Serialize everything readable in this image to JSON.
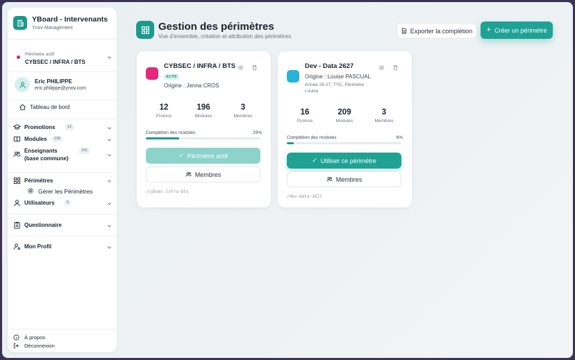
{
  "sidebar": {
    "brand_title": "YBoard - Intervenants",
    "brand_subtitle": "Ynov Management",
    "active_perimeter_label": "Périmètre actif",
    "active_perimeter_value": "CYBSEC / INFRA / BTS",
    "user_name": "Eric PHILIPPE",
    "user_email": "eric.philippe@ynov.com",
    "dashboard": "Tableau de bord",
    "promotions": {
      "label": "Promotions",
      "count": "12"
    },
    "modules": {
      "label": "Modules",
      "count": "196"
    },
    "teachers": {
      "label_line1": "Enseignants",
      "label_line2": "(base commune)",
      "count": "101"
    },
    "perimeters": "Périmètres",
    "manage_perimeters": "Gérer les Périmètres",
    "users": {
      "label": "Utilisateurs",
      "count": "5"
    },
    "questionnaire": "Questionnaire",
    "profile": "Mon Profil",
    "about": "À propos",
    "logout": "Déconnexion"
  },
  "header": {
    "title": "Gestion des périmètres",
    "subtitle": "Vue d'ensemble, création et attribution des périmètres",
    "export_label": "Exporter la complétion",
    "create_label": "Créer un périmètre"
  },
  "cards": [
    {
      "title": "CYBSEC / INFRA / BTS",
      "badge": "ACTIF",
      "origin": "Origine : Jenna CROS",
      "meta": "",
      "color": "#e3287e",
      "stats": [
        {
          "value": "12",
          "label": "Promos"
        },
        {
          "value": "196",
          "label": "Modules"
        },
        {
          "value": "3",
          "label": "Membres"
        }
      ],
      "progress_label": "Complétion des modules",
      "progress_pct_text": "29%",
      "progress": 29,
      "primary_label": "Périmètre actif",
      "members_label": "Membres",
      "slug": "/cybsec-infra-bts"
    },
    {
      "title": "Dev - Data 2627",
      "badge": "",
      "origin": "Origine : Louise PASCUAL",
      "meta": "Année 26-27, TYC, Périmètre Louise",
      "color": "#27b3d8",
      "stats": [
        {
          "value": "16",
          "label": "Promos"
        },
        {
          "value": "209",
          "label": "Modules"
        },
        {
          "value": "3",
          "label": "Membres"
        }
      ],
      "progress_label": "Complétion des modules",
      "progress_pct_text": "6%",
      "progress": 6,
      "primary_label": "Utiliser ce périmètre",
      "members_label": "Membres",
      "slug": "/dev-data-2627"
    }
  ]
}
